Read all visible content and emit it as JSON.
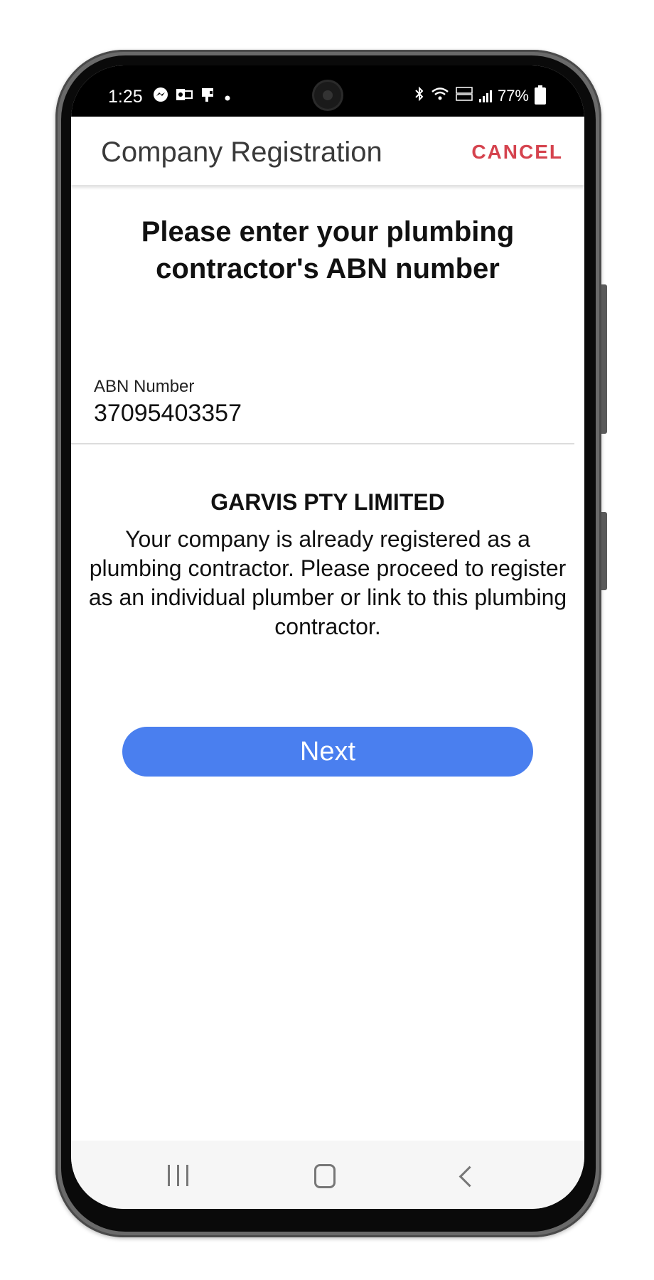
{
  "status_bar": {
    "time": "1:25",
    "left_icons": [
      "messenger-icon",
      "outlook-icon",
      "app-icon",
      "dot-icon"
    ],
    "right_icons": [
      "bluetooth-icon",
      "wifi-icon",
      "volte-icon",
      "signal-icon"
    ],
    "battery": "77%"
  },
  "app_bar": {
    "title": "Company Registration",
    "cancel_label": "CANCEL"
  },
  "main": {
    "headline": "Please enter your plumbing contractor's ABN number",
    "abn_field": {
      "label": "ABN Number",
      "value": "37095403357"
    },
    "company_name": "GARVIS PTY LIMITED",
    "message": "Your company is already registered as a plumbing contractor. Please proceed to register as an individual plumber or link to this plumbing contractor.",
    "next_label": "Next"
  },
  "colors": {
    "accent_button": "#4a7fef",
    "cancel_text": "#d5434e"
  },
  "nav_bar": {
    "icons": [
      "recents-icon",
      "home-icon",
      "back-icon"
    ]
  }
}
